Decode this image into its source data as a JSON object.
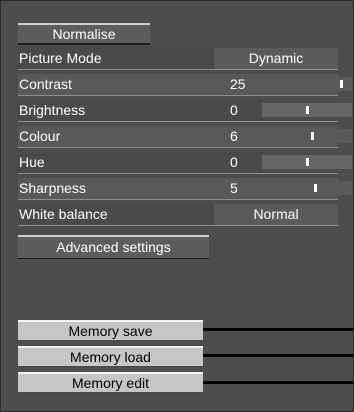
{
  "normalise": {
    "label": "Normalise"
  },
  "rows": [
    {
      "label": "Picture Mode",
      "value": "Dynamic"
    },
    {
      "label": "Contrast",
      "value": "25",
      "level": 0.9
    },
    {
      "label": "Brightness",
      "value": "0",
      "level": 0.5
    },
    {
      "label": "Colour",
      "value": "6",
      "level": 0.56
    },
    {
      "label": "Hue",
      "value": "0",
      "level": 0.5
    },
    {
      "label": "Sharpness",
      "value": "5",
      "level": 0.6
    },
    {
      "label": "White balance",
      "value": "Normal"
    }
  ],
  "advanced": {
    "label": "Advanced settings"
  },
  "memory": {
    "save_label": "Memory save",
    "load_label": "Memory load",
    "edit_label": "Memory edit"
  },
  "colors": {
    "background": "#4d4d4d",
    "text": "#ffffff",
    "memory_button": "#c6c6c6",
    "slider_marker": "#ffffff"
  }
}
